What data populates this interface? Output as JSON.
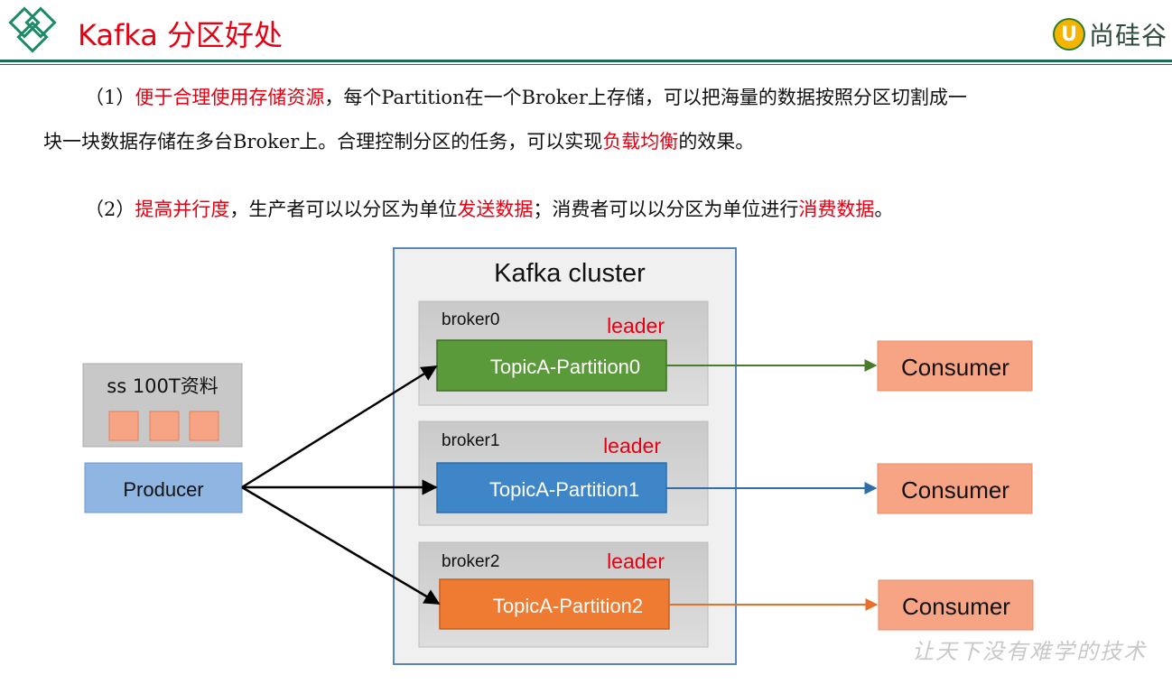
{
  "header": {
    "title": "Kafka 分区好处",
    "brand": "尚硅谷",
    "brand_mark": "U"
  },
  "paragraphs": [
    {
      "segments": [
        {
          "text": "（1）",
          "style": "normal"
        },
        {
          "text": "便于合理使用存储资源",
          "style": "red"
        },
        {
          "text": "，每个Partition在一个Broker上存储，可以把海量的数据按照分区切割成一",
          "style": "normal"
        }
      ]
    },
    {
      "segments": [
        {
          "text": "块一块数据存储在多台Broker上。合理控制分区的任务，可以实现",
          "style": "normal"
        },
        {
          "text": "负载均衡",
          "style": "red"
        },
        {
          "text": "的效果。",
          "style": "normal"
        }
      ]
    },
    {
      "segments": [
        {
          "text": "（2）",
          "style": "normal"
        },
        {
          "text": "提高并行度",
          "style": "red"
        },
        {
          "text": "，生产者可以以分区为单位",
          "style": "normal"
        },
        {
          "text": "发送数据",
          "style": "red"
        },
        {
          "text": "；消费者可以以分区为单位进行",
          "style": "normal"
        },
        {
          "text": "消费数据",
          "style": "red"
        },
        {
          "text": "。",
          "style": "normal"
        }
      ]
    }
  ],
  "diagram": {
    "cluster_label": "Kafka cluster",
    "data_source_label": "ss 100T资料",
    "producer_label": "Producer",
    "brokers": [
      {
        "name": "broker0",
        "role": "leader",
        "partition": "TopicA-Partition0",
        "color": "#5b9a3a",
        "consumer": "Consumer"
      },
      {
        "name": "broker1",
        "role": "leader",
        "partition": "TopicA-Partition1",
        "color": "#3f86c8",
        "consumer": "Consumer"
      },
      {
        "name": "broker2",
        "role": "leader",
        "partition": "TopicA-Partition2",
        "color": "#ef7a31",
        "consumer": "Consumer"
      }
    ],
    "colors": {
      "cluster_border": "#5a86b8",
      "cluster_fill": "#f0f0f0",
      "broker_fill": "#d0d0d0",
      "producer_fill": "#8fb6e3",
      "consumer_fill": "#f7a484",
      "leader_text": "#e60012"
    }
  },
  "watermark": "让天下没有难学的技术"
}
